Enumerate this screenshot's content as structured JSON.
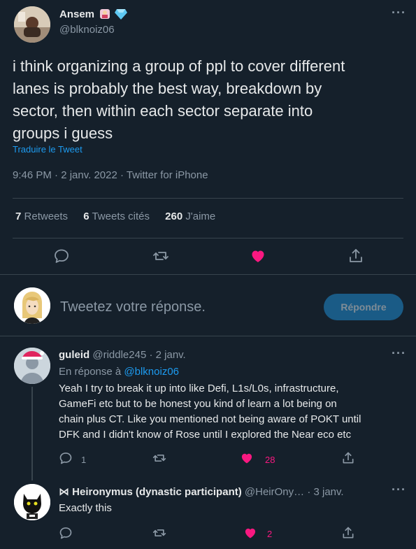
{
  "main_tweet": {
    "author_name": "Ansem",
    "handle": "@blknoiz06",
    "text_lines": [
      "i think organizing a group of ppl to cover different",
      "lanes is probably the best way, breakdown by",
      "sector, then within each sector separate into",
      "groups i guess"
    ],
    "translate_label": "Traduire le Tweet",
    "timestamp": "9:46 PM · 2 janv. 2022 · Twitter for iPhone",
    "stats": {
      "retweets_count": "7",
      "retweets_label": "Retweets",
      "quotes_count": "6",
      "quotes_label": "Tweets cités",
      "likes_count": "260",
      "likes_label": "J'aime"
    }
  },
  "reply_box": {
    "placeholder": "Tweetez votre réponse.",
    "button_label": "Répondre"
  },
  "replies": [
    {
      "author_name": "guleid",
      "handle": "@riddle245",
      "separator": "·",
      "date": "2 janv.",
      "in_reply_prefix": "En réponse à",
      "in_reply_handle": "@blknoiz06",
      "text_lines": [
        "Yeah I try to break it up into like Defi, L1s/L0s, infrastructure,",
        "GameFi etc but to be honest you kind of learn a lot being on",
        "chain plus CT. Like you mentioned not being aware of POKT  until",
        "DFK and I didn't know of Rose until I explored the Near eco  etc"
      ],
      "reply_count": "1",
      "like_count": "28"
    },
    {
      "author_name": "⋈ Heironymus (dynastic participant)",
      "handle": "@HeirOny…",
      "separator": "·",
      "date": "3 janv.",
      "text": "Exactly this",
      "like_count": "2"
    }
  ],
  "colors": {
    "background": "#15202b",
    "accent": "#1d9bf0",
    "like": "#f91880",
    "muted": "#8b98a5",
    "divider": "#38444d"
  }
}
